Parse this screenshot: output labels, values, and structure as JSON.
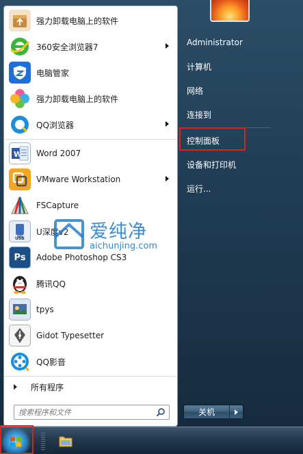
{
  "start_menu": {
    "programs": [
      {
        "label": "强力卸载电脑上的软件",
        "icon": "uninstall-package-icon",
        "color": "#e07b2a",
        "submenu": false
      },
      {
        "label": "360安全浏览器7",
        "icon": "360-browser-icon",
        "color": "#2ea82e",
        "submenu": true
      },
      {
        "label": "电脑管家",
        "icon": "pc-manager-shield-icon",
        "color": "#1f6fd6",
        "submenu": false
      },
      {
        "label": "强力卸载电脑上的软件",
        "icon": "colorful-flower-icon",
        "color": "#e44d8a",
        "submenu": false
      },
      {
        "label": "QQ浏览器",
        "icon": "qq-browser-icon",
        "color": "#1a8fe0",
        "submenu": true
      },
      {
        "label": "Word 2007",
        "icon": "word-icon",
        "color": "#2a5ba8",
        "submenu": false
      },
      {
        "label": "VMware Workstation",
        "icon": "vmware-icon",
        "color": "#f0a020",
        "submenu": true
      },
      {
        "label": "FSCapture",
        "icon": "fscapture-icon",
        "color": "#d8332a",
        "submenu": false
      },
      {
        "label": "U深度v2",
        "icon": "usb-drive-icon",
        "color": "#3a6ec0",
        "submenu": false
      },
      {
        "label": "Adobe Photoshop CS3",
        "icon": "photoshop-icon",
        "color": "#1d4f86",
        "submenu": false
      },
      {
        "label": "腾讯QQ",
        "icon": "qq-penguin-icon",
        "color": "#222222",
        "submenu": false
      },
      {
        "label": "tpys",
        "icon": "tpys-app-icon",
        "color": "#4a6da0",
        "submenu": false
      },
      {
        "label": "Gidot Typesetter",
        "icon": "gidot-pen-icon",
        "color": "#555555",
        "submenu": false
      },
      {
        "label": "QQ影音",
        "icon": "qq-player-icon",
        "color": "#1a8fe0",
        "submenu": false
      }
    ],
    "all_programs_label": "所有程序",
    "search": {
      "placeholder": "搜索程序和文件"
    },
    "right_items": [
      {
        "label": "Administrator"
      },
      {
        "label": "计算机"
      },
      {
        "label": "网络"
      },
      {
        "label": "连接到"
      },
      {
        "label": "控制面板"
      },
      {
        "label": "设备和打印机"
      },
      {
        "label": "运行..."
      }
    ],
    "shutdown_label": "关机",
    "highlight_color": "#e0201b"
  },
  "watermark": {
    "title": "爱纯净",
    "url": "aichunjing.com"
  }
}
